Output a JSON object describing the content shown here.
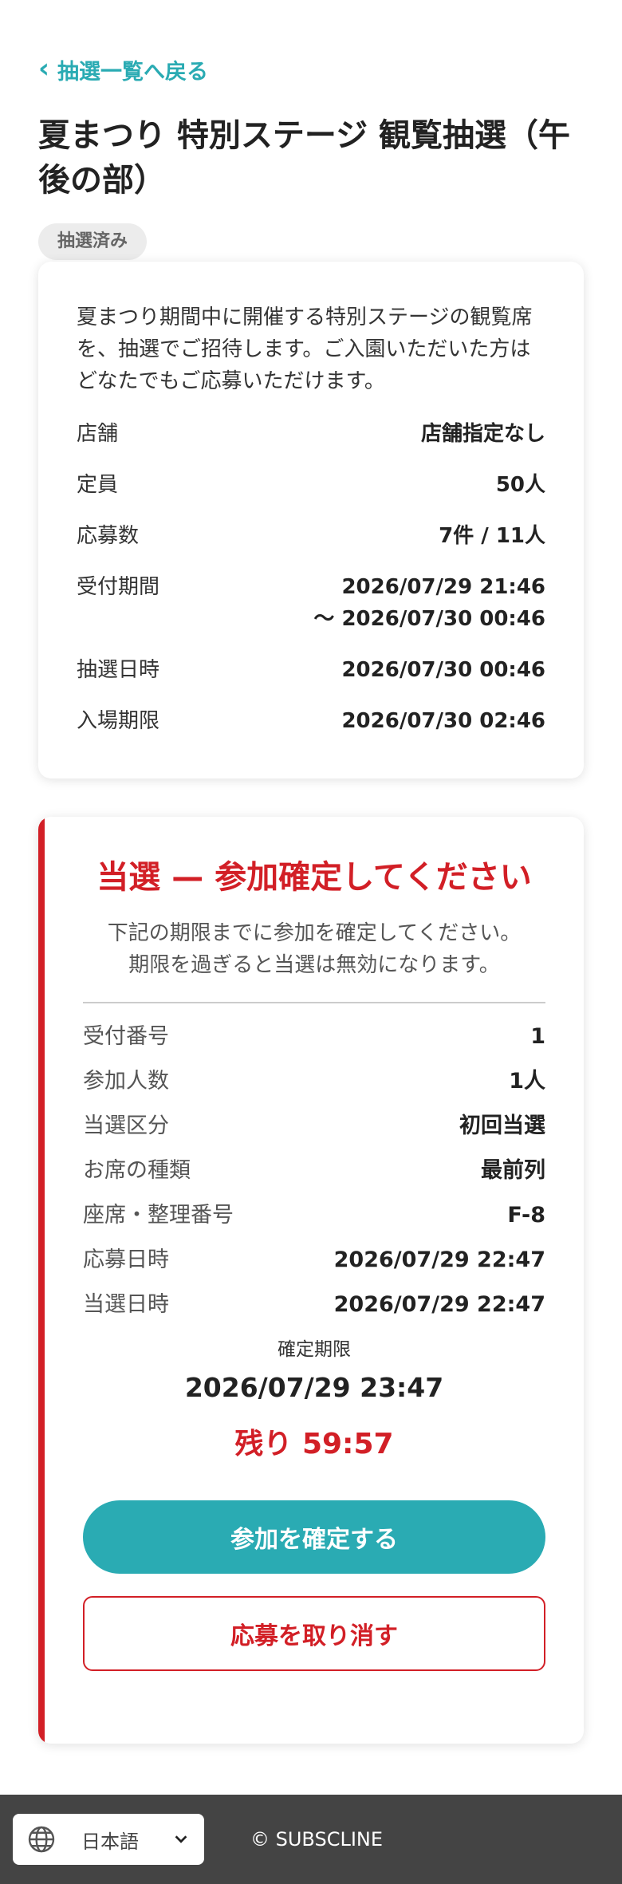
{
  "nav": {
    "back_label": "抽選一覧へ戻る"
  },
  "page": {
    "title": "夏まつり 特別ステージ 観覧抽選（午後の部）",
    "status_badge": "抽選済み"
  },
  "info": {
    "description": "夏まつり期間中に開催する特別ステージの観覧席を、抽選でご招待します。ご入園いただいた方はどなたでもご応募いただけます。",
    "rows": [
      {
        "label": "店舗",
        "value": "店舗指定なし"
      },
      {
        "label": "定員",
        "value": "50人"
      },
      {
        "label": "応募数",
        "value": "7件 / 11人"
      },
      {
        "label": "受付期間",
        "value": "2026/07/29 21:46",
        "value2": "〜 2026/07/30 00:46"
      },
      {
        "label": "抽選日時",
        "value": "2026/07/30 00:46"
      },
      {
        "label": "入場期限",
        "value": "2026/07/30 02:46"
      }
    ]
  },
  "result": {
    "title": "当選 — 参加確定してください",
    "note_line1": "下記の期限までに参加を確定してください。",
    "note_line2": "期限を過ぎると当選は無効になります。",
    "rows": [
      {
        "label": "受付番号",
        "value": "1"
      },
      {
        "label": "参加人数",
        "value": "1人"
      },
      {
        "label": "当選区分",
        "value": "初回当選"
      },
      {
        "label": "お席の種類",
        "value": "最前列"
      },
      {
        "label": "座席・整理番号",
        "value": "F-8"
      },
      {
        "label": "応募日時",
        "value": "2026/07/29 22:47"
      },
      {
        "label": "当選日時",
        "value": "2026/07/29 22:47"
      }
    ],
    "deadline_label": "確定期限",
    "deadline_value": "2026/07/29 23:47",
    "remaining": "残り 59:57",
    "confirm_label": "参加を確定する",
    "cancel_label": "応募を取り消す"
  },
  "footer": {
    "language": "日本語",
    "copyright": "© SUBSCLINE"
  },
  "colors": {
    "accent_teal": "#2aabb3",
    "alert_red": "#d21f26",
    "footer_bg": "#444444"
  }
}
